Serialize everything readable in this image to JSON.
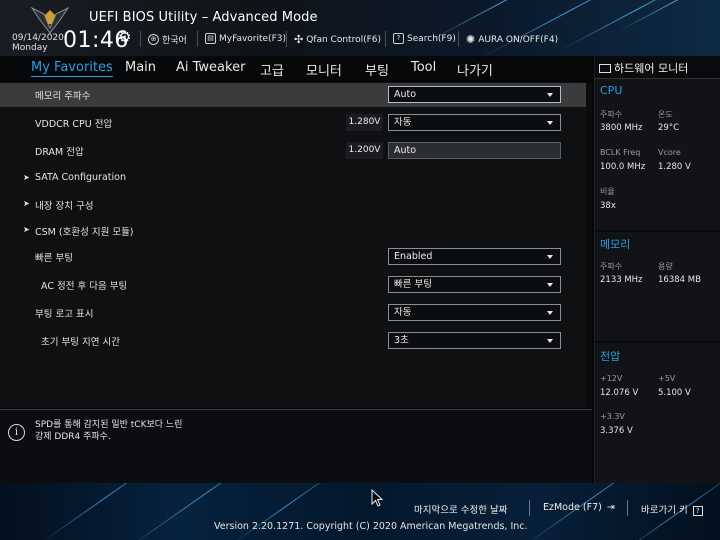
{
  "header": {
    "title": "UEFI BIOS Utility – Advanced Mode",
    "date": "09/14/2020",
    "day": "Monday",
    "time": "01:46",
    "tools": [
      {
        "label": "한국어",
        "icon": "globe-icon"
      },
      {
        "label": "MyFavorite(F3)",
        "icon": "favorite-icon"
      },
      {
        "label": "Qfan Control(F6)",
        "icon": "fan-icon"
      },
      {
        "label": "Search(F9)",
        "icon": "search-icon"
      },
      {
        "label": "AURA ON/OFF(F4)",
        "icon": "aura-icon"
      }
    ]
  },
  "tabs": [
    "My Favorites",
    "Main",
    "Ai Tweaker",
    "고급",
    "모니터",
    "부팅",
    "Tool",
    "나가기"
  ],
  "active_tab": "My Favorites",
  "settings": [
    {
      "label": "메모리 주파수",
      "control": "dropdown",
      "value": "Auto",
      "selected": true
    },
    {
      "label": "VDDCR CPU 전압",
      "control": "dropdown",
      "current": "1.280V",
      "value": "자동"
    },
    {
      "label": "DRAM 전압",
      "control": "text",
      "current": "1.200V",
      "value": "Auto"
    },
    {
      "label": "SATA Configuration",
      "control": "submenu"
    },
    {
      "label": "내장 장치 구성",
      "control": "submenu"
    },
    {
      "label": "CSM (호환성 지원 모듈)",
      "control": "submenu"
    },
    {
      "label": "빠른 부팅",
      "control": "dropdown",
      "value": "Enabled"
    },
    {
      "label": "AC 정전 후 다음 부팅",
      "control": "dropdown",
      "value": "빠른 부팅"
    },
    {
      "label": "부팅 로고 표시",
      "control": "dropdown",
      "value": "자동"
    },
    {
      "label": "초기 부팅 지연 시간",
      "control": "dropdown",
      "value": "3초"
    }
  ],
  "help": {
    "line1": "SPD를 통해 감지된 일반 tCK보다 느린",
    "line2": "강제 DDR4 주파수."
  },
  "hardware_monitor": {
    "title": "하드웨어 모니터",
    "cpu": {
      "section": "CPU",
      "freq_label": "주파수",
      "freq": "3800 MHz",
      "temp_label": "온도",
      "temp": "29°C",
      "bclk_label": "BCLK Freq",
      "bclk": "100.0 MHz",
      "vcore_label": "Vcore",
      "vcore": "1.280 V",
      "ratio_label": "비율",
      "ratio": "38x"
    },
    "memory": {
      "section": "메모리",
      "freq_label": "주파수",
      "freq": "2133 MHz",
      "cap_label": "용량",
      "cap": "16384 MB"
    },
    "voltage": {
      "section": "전압",
      "v12_label": "+12V",
      "v12": "12.076 V",
      "v5_label": "+5V",
      "v5": "5.100 V",
      "v33_label": "+3.3V",
      "v33": "3.376 V"
    }
  },
  "footer": {
    "last_modified": "마지막으로 수정한 날짜",
    "ezmode": "EzMode (F7)",
    "hotkeys": "바로가기 키",
    "copyright": "Version 2.20.1271. Copyright (C) 2020 American Megatrends, Inc."
  },
  "colors": {
    "accent": "#28a0e8",
    "section": "#2a9ee6"
  }
}
